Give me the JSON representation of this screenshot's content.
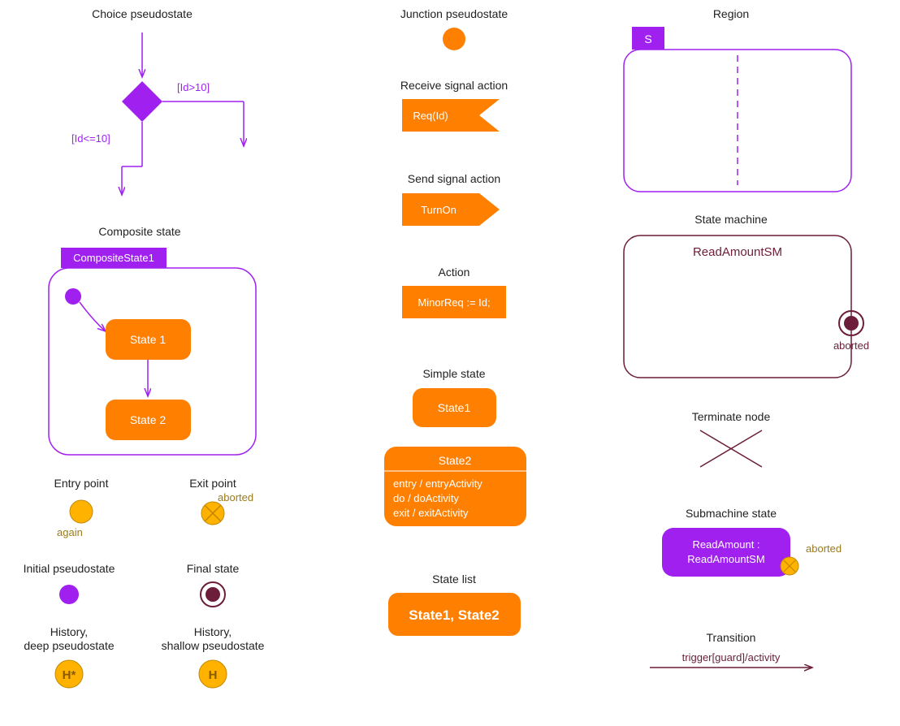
{
  "choice_pseudostate": {
    "title": "Choice pseudostate",
    "guard_right": "[Id>10]",
    "guard_down": "[Id<=10]"
  },
  "composite_state": {
    "title": "Composite state",
    "name": "CompositeState1",
    "state1": "State 1",
    "state2": "State 2"
  },
  "entry_point": {
    "title": "Entry point",
    "label": "again"
  },
  "exit_point": {
    "title": "Exit point",
    "label": "aborted"
  },
  "initial_pseudostate": {
    "title": "Initial pseudostate"
  },
  "final_state": {
    "title": "Final state"
  },
  "history_deep": {
    "title": "History,\ndeep pseudostate",
    "label": "H*"
  },
  "history_shallow": {
    "title": "History,\nshallow pseudostate",
    "label": "H"
  },
  "junction_pseudostate": {
    "title": "Junction pseudostate"
  },
  "receive_signal": {
    "title": "Receive signal action",
    "content": "Req(Id)"
  },
  "send_signal": {
    "title": "Send signal action",
    "content": "TurnOn"
  },
  "action": {
    "title": "Action",
    "content": "MinorReq := Id;"
  },
  "simple_state": {
    "title": "Simple state",
    "content": "State1"
  },
  "state2_detail": {
    "name": "State2",
    "entry": "entry / entryActivity",
    "do": "do / doActivity",
    "exit": "exit / exitActivity"
  },
  "state_list": {
    "title": "State list",
    "content": "State1, State2"
  },
  "region": {
    "title": "Region",
    "label": "S"
  },
  "state_machine": {
    "title": "State machine",
    "name": "ReadAmountSM",
    "exit_label": "aborted"
  },
  "terminate_node": {
    "title": "Terminate node"
  },
  "submachine_state": {
    "title": "Submachine state",
    "content": "ReadAmount :\nReadAmountSM",
    "exit_label": "aborted"
  },
  "transition": {
    "title": "Transition",
    "content": "trigger[guard]/activity"
  },
  "colors": {
    "purple": "#a020f0",
    "orange": "#ff7f00",
    "dark_orange": "#e0a000",
    "maroon": "#6b1d3a",
    "brown_text": "#9a7a1a"
  }
}
